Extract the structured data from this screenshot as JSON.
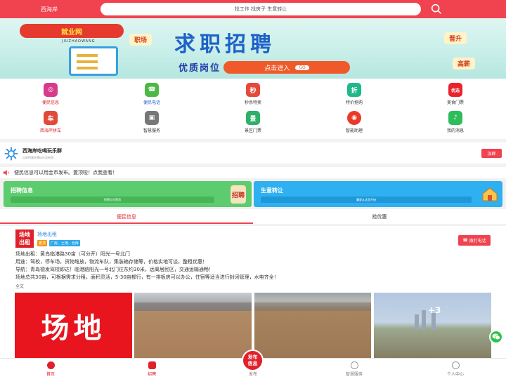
{
  "header": {
    "city": "西海岸",
    "search_placeholder": "找工作 找房子 生意转让"
  },
  "banner": {
    "logo_text": "就业网",
    "logo_sub": "JIUZHAOWANG",
    "headline": "求职招聘",
    "tagline": "优质岗位 海量人才",
    "enter_label": "点击进入",
    "go_label": "GO",
    "tags": [
      "职场",
      "晋升",
      "高薪"
    ]
  },
  "grid": {
    "items": [
      {
        "label": "便民信息",
        "icon": "instagram-icon",
        "color": "#d83a8c"
      },
      {
        "label": "便民电话",
        "icon": "phone-icon",
        "color": "#4db848"
      },
      {
        "label": "秒杀特卖",
        "icon": "flash-sale-icon",
        "color": "#e4493a"
      },
      {
        "label": "特价抢购",
        "icon": "discount-icon",
        "color": "#1fb88a"
      },
      {
        "label": "美食门票",
        "icon": "food-ticket-icon",
        "color": "#e8232c"
      },
      {
        "label": "西海岸拼车",
        "icon": "car-icon",
        "color": "#e04a3a"
      },
      {
        "label": "智慧服务",
        "icon": "box-icon",
        "color": "#777777"
      },
      {
        "label": "景区门票",
        "icon": "scenic-icon",
        "color": "#2fb06a"
      },
      {
        "label": "智能助理",
        "icon": "assistant-icon",
        "color": "#e93a2a"
      },
      {
        "label": "我的消息",
        "icon": "bell-icon",
        "color": "#2ebd5a"
      }
    ],
    "symbols": [
      "◎",
      "☎",
      "秒",
      "折",
      "优选",
      "车",
      "▣",
      "景",
      "◉",
      "♪"
    ]
  },
  "group": {
    "name": "西海岸吃喝玩乐群",
    "desc": "吉林特惠吃喝玩乐没有钱",
    "join_label": "加群"
  },
  "notice": {
    "text": "便民信息可以用金币发布。置顶啦！点我查看！"
  },
  "cards": {
    "recruit": {
      "title": "招聘信息",
      "button": "招聘当天置顶",
      "seal": "招聘"
    },
    "transfer": {
      "title": "生意转让",
      "button": "暑夏从这里开始"
    }
  },
  "tabs": [
    "便民信息",
    "抢优惠"
  ],
  "post": {
    "avatar_line1": "场地",
    "avatar_line2": "出租",
    "title": "场地出租",
    "badges": [
      "置顶",
      "厂房、土地、仓库"
    ],
    "call_label": "拨打电话",
    "lines": [
      "场地出租：黄岛临港路30亩（可分开）阳光一号北门",
      "用途：驾校，停车场，货物堆放，物流车队，集装箱存储等，价格实地可谈，整租优惠！",
      "导航：青岛德发驾校即达！临港路阳光一号北门往东约30米，远离居民区，交通运输通畅！",
      "场地总共30亩，可根据需求分租，面积灵活，5-30亩都行，有一排板房可以办公，住宿等适当进行封闭管理，水电齐全！"
    ],
    "full_text": "全文",
    "photo1_text": "场地",
    "more_photos": "+3"
  },
  "bottom_nav": [
    "首页",
    "招聘",
    "发布",
    "智慧服务",
    "个人中心"
  ],
  "publish_label": [
    "发布",
    "信息"
  ]
}
